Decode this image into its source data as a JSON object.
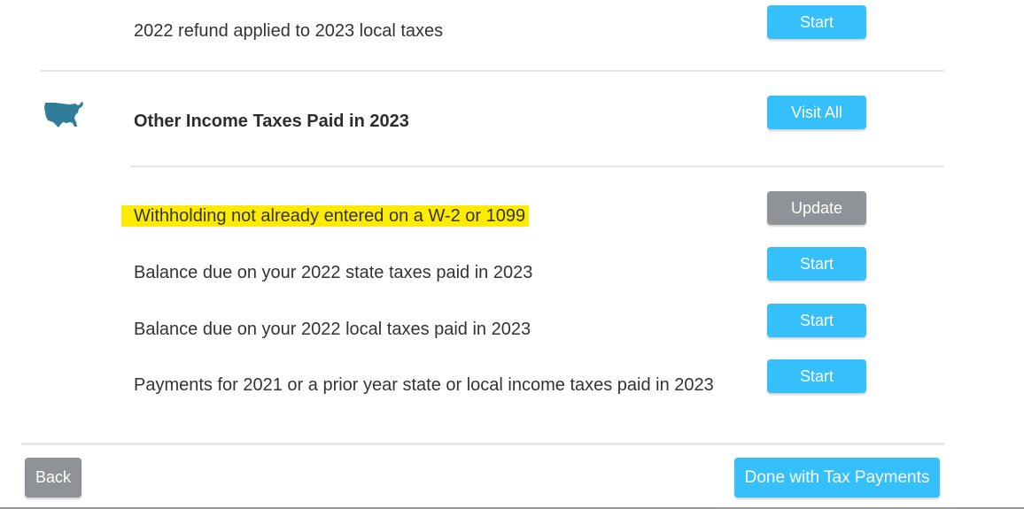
{
  "section_local": {
    "row_refund_local": {
      "label": "2022 refund applied to 2023 local taxes",
      "button": "Start"
    }
  },
  "section_other": {
    "title": "Other Income Taxes Paid in 2023",
    "visit_all_label": "Visit All",
    "icon": "us-map-icon",
    "rows": [
      {
        "label": "Withholding not already entered on a W-2 or 1099",
        "button": "Update",
        "highlighted": true
      },
      {
        "label": "Balance due on your 2022 state taxes paid in 2023",
        "button": "Start"
      },
      {
        "label": "Balance due on your 2022 local taxes paid in 2023",
        "button": "Start"
      },
      {
        "label": "Payments for 2021 or a prior year state or local income taxes paid in 2023",
        "button": "Start"
      }
    ]
  },
  "footer": {
    "back_label": "Back",
    "done_label": "Done with Tax Payments"
  },
  "colors": {
    "primary_button": "#35c0fb",
    "secondary_button": "#8f9296",
    "highlight": "#ffeb00",
    "icon": "#2f7d99"
  }
}
